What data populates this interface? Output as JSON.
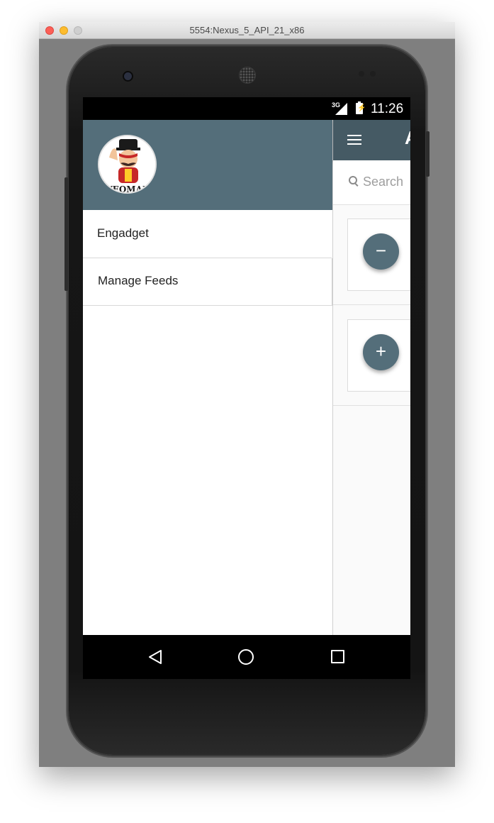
{
  "window": {
    "title": "5554:Nexus_5_API_21_x86"
  },
  "status_bar": {
    "network": "3G",
    "time": "11:26"
  },
  "toolbar": {
    "title": "A"
  },
  "search": {
    "placeholder": "Search"
  },
  "cards": [
    {
      "fab_label": "−"
    },
    {
      "fab_label": "+"
    }
  ],
  "drawer": {
    "avatar_text": "YEOMAN",
    "items": [
      {
        "label": "Engadget"
      },
      {
        "label": "Manage Feeds"
      }
    ]
  },
  "colors": {
    "toolbar": "#455a64",
    "drawer_header": "#546e7a",
    "fab": "#546e7a",
    "screen_bg": "#fafafa"
  },
  "icons": {
    "menu": "hamburger-icon",
    "search": "search-icon",
    "back": "back-triangle-icon",
    "home": "home-circle-icon",
    "recent": "recent-apps-icon"
  }
}
